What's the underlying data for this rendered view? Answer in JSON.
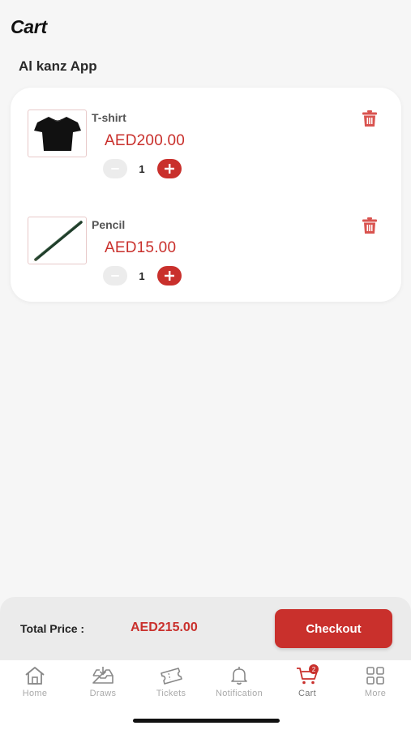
{
  "header": {
    "title": "Cart",
    "store_name": "Al kanz App"
  },
  "cart": {
    "items": [
      {
        "name": "T-shirt",
        "price": "AED200.00",
        "quantity": "1",
        "thumbnail_icon": "tshirt-image"
      },
      {
        "name": "Pencil",
        "price": "AED15.00",
        "quantity": "1",
        "thumbnail_icon": "pencil-image"
      }
    ]
  },
  "summary": {
    "total_label": "Total Price :",
    "total_value": "AED215.00",
    "checkout_label": "Checkout"
  },
  "tabs": [
    {
      "label": "Home",
      "icon": "home-icon"
    },
    {
      "label": "Draws",
      "icon": "inbox-icon"
    },
    {
      "label": "Tickets",
      "icon": "ticket-icon"
    },
    {
      "label": "Notification",
      "icon": "bell-icon"
    },
    {
      "label": "Cart",
      "icon": "cart-icon",
      "active": true,
      "badge": "2"
    },
    {
      "label": "More",
      "icon": "grid-icon"
    }
  ],
  "colors": {
    "accent": "#c9302c",
    "background": "#f6f6f6",
    "card": "#ffffff"
  }
}
